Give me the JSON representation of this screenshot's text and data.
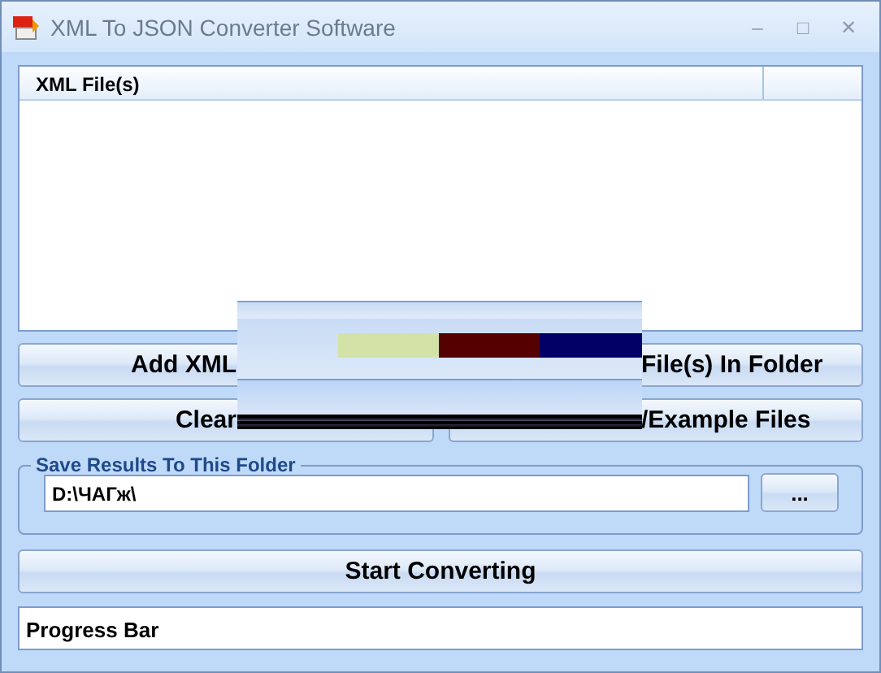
{
  "window": {
    "title": "XML To JSON Converter Software",
    "controls": [
      "–",
      "□",
      "✕"
    ]
  },
  "file_list": {
    "columns": [
      "XML File(s)"
    ]
  },
  "buttons": [
    {
      "label": "Add XML"
    },
    {
      "label": "File(s) In Folder"
    },
    {
      "label": "Clear"
    },
    {
      "label": "/Example Files"
    }
  ],
  "save_folder": {
    "legend": "Save Results To This Folder",
    "value": "D:\\ЧАГж\\",
    "browse": "..."
  },
  "start_button": "Start Converting",
  "progress": {
    "label": "Progress Bar",
    "level": 0
  }
}
